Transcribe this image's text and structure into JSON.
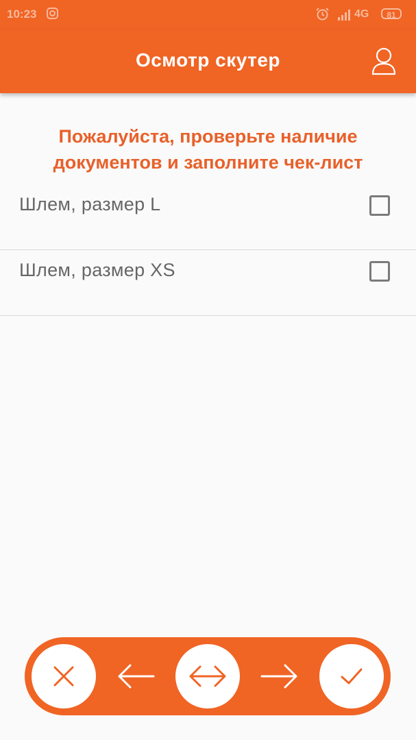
{
  "status_bar": {
    "time": "10:23",
    "network": "4G",
    "battery": "81",
    "icons": [
      "instagram-icon",
      "alarm-icon",
      "signal-icon",
      "battery-icon"
    ]
  },
  "app_bar": {
    "title": "Осмотр скутер",
    "profile_icon": "user-icon"
  },
  "instruction": "Пожалуйста, проверьте наличие документов и заполните чек-лист",
  "checklist": [
    {
      "label": "Шлем, размер L",
      "checked": false
    },
    {
      "label": "Шлем, размер XS",
      "checked": false
    }
  ],
  "bottom_nav": {
    "buttons": [
      "close-icon",
      "arrow-left-icon",
      "swap-icon",
      "arrow-right-icon",
      "check-icon"
    ]
  },
  "colors": {
    "accent": "#f06424",
    "instruction_text": "#e8612a",
    "item_text": "#666666",
    "background": "#fafafa"
  }
}
